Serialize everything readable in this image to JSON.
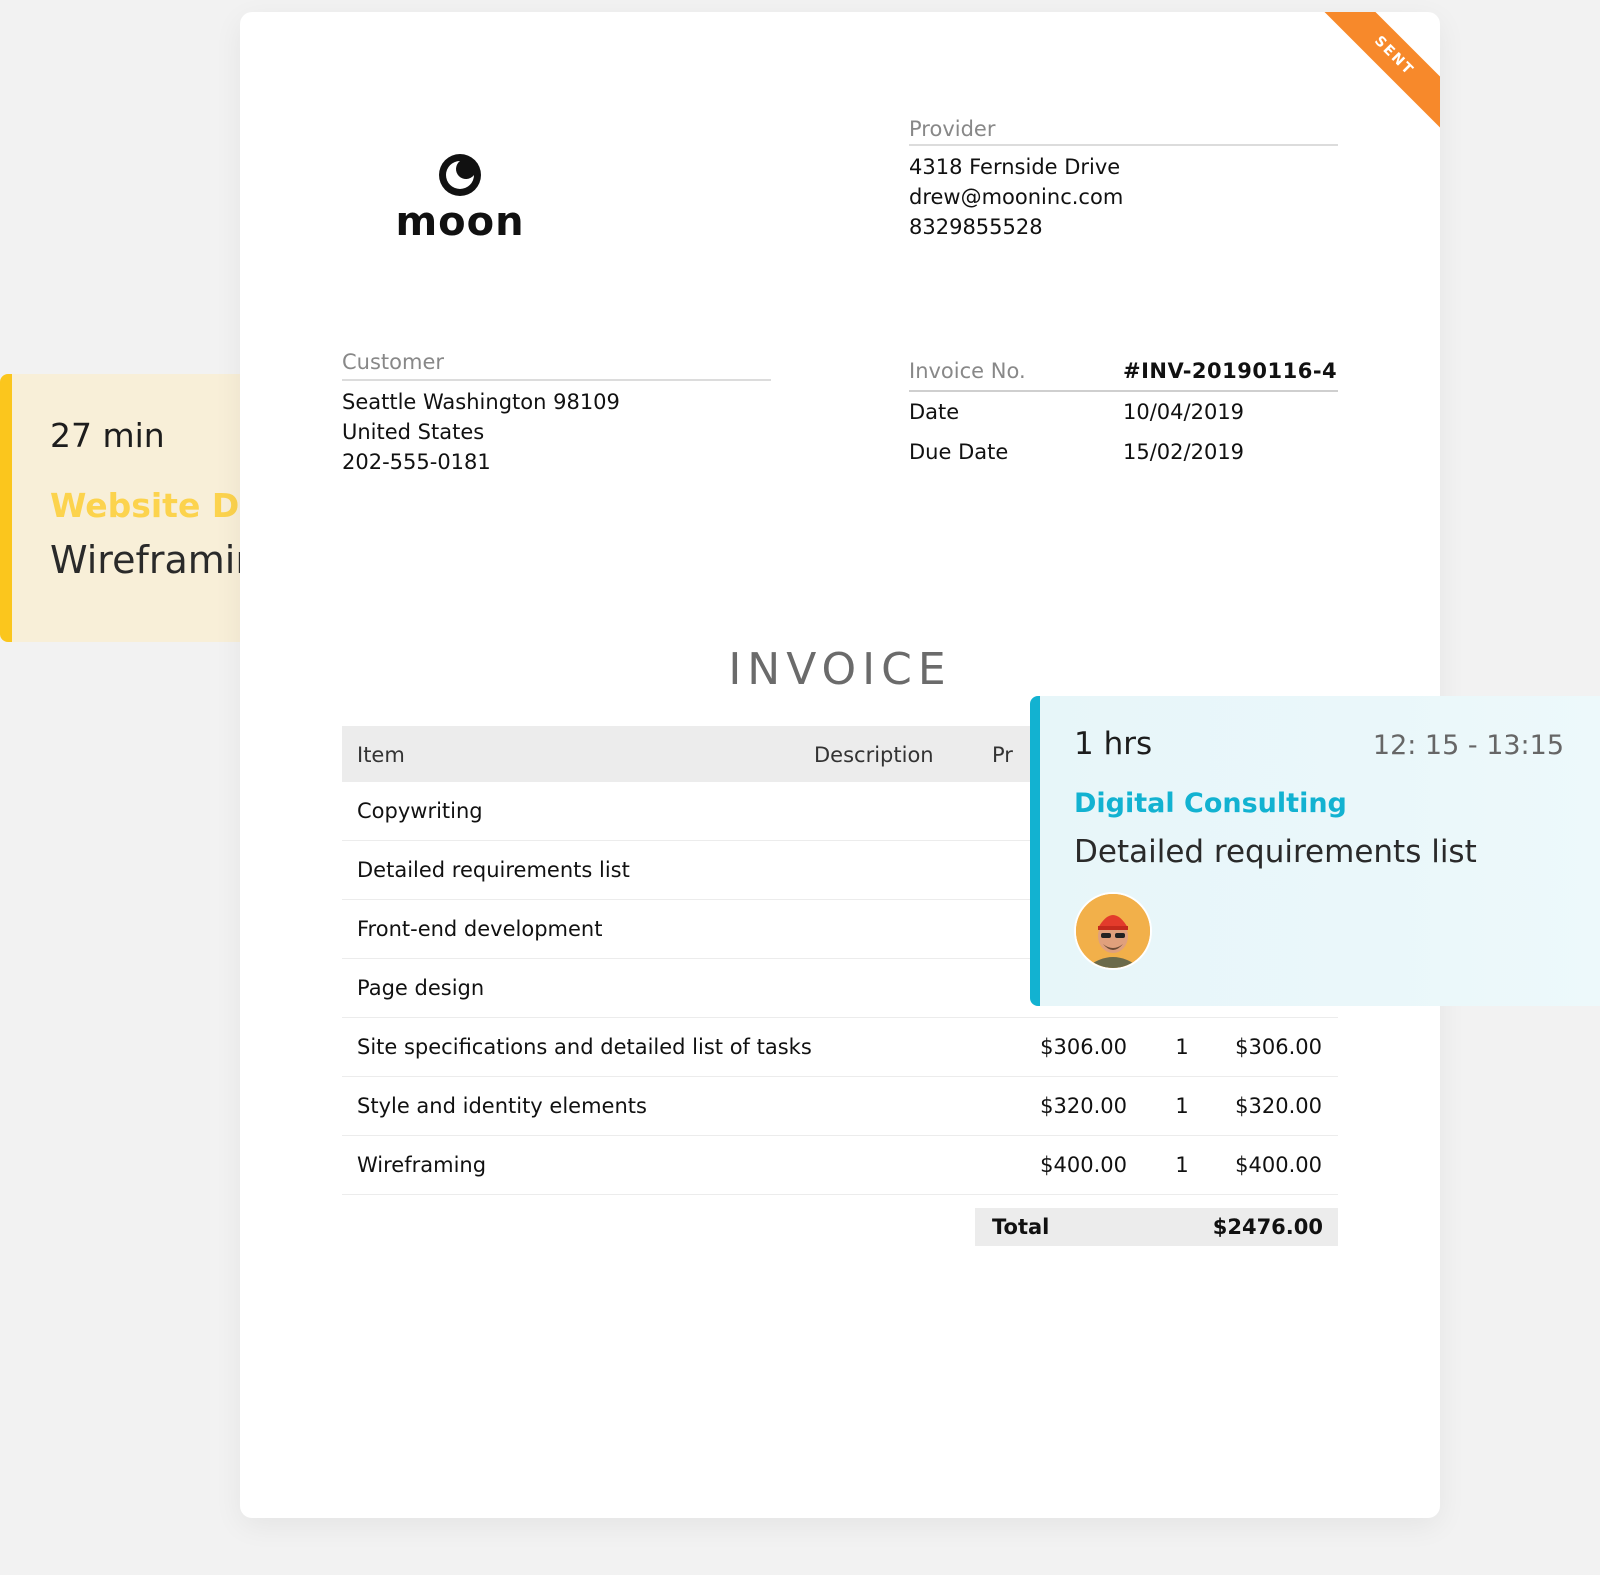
{
  "yellow_card": {
    "duration": "27 min",
    "project": "Website Des",
    "task": "Wireframin",
    "accent_color": "#fbc61d"
  },
  "invoice": {
    "status_ribbon": "SENT",
    "logo_text": "moon",
    "provider": {
      "label": "Provider",
      "address": "4318 Fernside Drive",
      "email": "drew@mooninc.com",
      "phone": "8329855528"
    },
    "customer": {
      "label": "Customer",
      "address": "Seattle Washington 98109",
      "country": "United States",
      "phone": "202-555-0181"
    },
    "meta": {
      "number_label": "Invoice No.",
      "number": "#INV-20190116-4",
      "date_label": "Date",
      "date": "10/04/2019",
      "due_label": "Due Date",
      "due": "15/02/2019"
    },
    "title": "INVOICE",
    "columns": {
      "item": "Item",
      "description": "Description",
      "price": "Pr"
    },
    "items": [
      {
        "item": "Copywriting",
        "price": "",
        "qty": "",
        "amount": ""
      },
      {
        "item": "Detailed requirements list",
        "price": "",
        "qty": "",
        "amount": ""
      },
      {
        "item": "Front-end development",
        "price": "",
        "qty": "",
        "amount": ""
      },
      {
        "item": "Page design",
        "price": "",
        "qty": "",
        "amount": ""
      },
      {
        "item": "Site specifications and detailed list of tasks",
        "price": "$306.00",
        "qty": "1",
        "amount": "$306.00"
      },
      {
        "item": "Style and identity elements",
        "price": "$320.00",
        "qty": "1",
        "amount": "$320.00"
      },
      {
        "item": "Wireframing",
        "price": "$400.00",
        "qty": "1",
        "amount": "$400.00"
      }
    ],
    "total_label": "Total",
    "total": "$2476.00",
    "ribbon_color": "#f7892b"
  },
  "cyan_card": {
    "hours": "1 hrs",
    "time_range": "12: 15 - 13:15",
    "project": "Digital Consulting",
    "task": "Detailed requirements list",
    "avatar_icon": "avatar-person-red-helmet",
    "accent_color": "#12b2d1"
  }
}
